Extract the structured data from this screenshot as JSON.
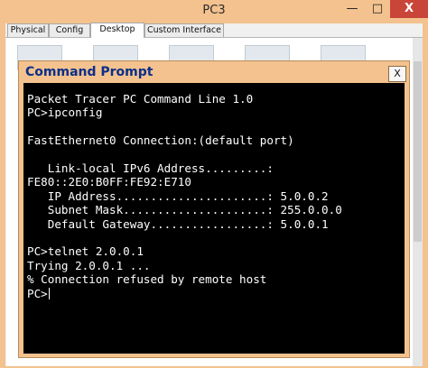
{
  "window": {
    "title": "PC3",
    "minimize": "—",
    "maximize": "□",
    "close": "X"
  },
  "tabs": [
    {
      "label": "Physical"
    },
    {
      "label": "Config"
    },
    {
      "label": "Desktop"
    },
    {
      "label": "Custom Interface"
    }
  ],
  "command_prompt": {
    "title": "Command Prompt",
    "close_label": "X",
    "terminal_lines": [
      "Packet Tracer PC Command Line 1.0",
      "PC>ipconfig",
      "",
      "FastEthernet0 Connection:(default port)",
      "",
      "   Link-local IPv6 Address.........:",
      "FE80::2E0:B0FF:FE92:E710",
      "   IP Address......................: 5.0.0.2",
      "   Subnet Mask.....................: 255.0.0.0",
      "   Default Gateway.................: 5.0.0.1",
      "",
      "PC>telnet 2.0.0.1",
      "Trying 2.0.0.1 ...",
      "% Connection refused by remote host"
    ],
    "prompt": "PC>"
  },
  "colors": {
    "frame": "#f3c28e",
    "terminal_bg": "#000000",
    "terminal_fg": "#ffffff",
    "cmd_title": "#0b2f8a",
    "close_red": "#c9453a"
  }
}
